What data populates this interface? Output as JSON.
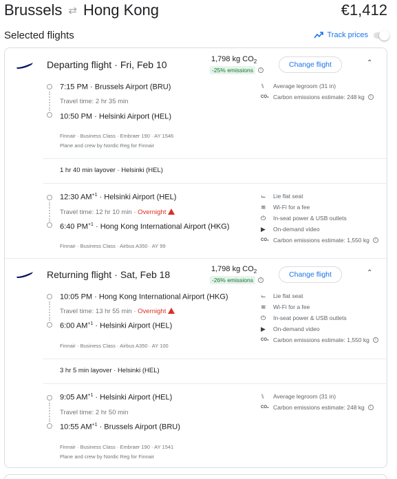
{
  "header": {
    "origin": "Brussels",
    "destination": "Hong Kong",
    "price": "€1,412"
  },
  "selected_title": "Selected flights",
  "track_prices": {
    "label": "Track prices",
    "enabled": false
  },
  "colors": {
    "accent": "#1a73e8",
    "warning": "#d93025",
    "eco_bg": "#e6f4ea",
    "eco_text": "#137333"
  },
  "departing": {
    "title": "Departing flight",
    "date": "Fri, Feb 10",
    "co2": "1,798 kg CO",
    "co2_sub": "2",
    "emissions_badge": "-25% emissions",
    "change_label": "Change flight",
    "segments": [
      {
        "dep_time": "7:15 PM",
        "dep_sup": "",
        "dep_airport": "Brussels Airport (BRU)",
        "travel_time": "Travel time: 2 hr 35 min",
        "overnight": "",
        "arr_time": "10:50 PM",
        "arr_sup": "",
        "arr_airport": "Helsinki Airport (HEL)",
        "details": "Finnair · Business Class · Embraer 190 · AY 1546",
        "operated": "Plane and crew by Nordic Reg for Finnair",
        "amenities": [
          {
            "icon": "legroom-icon",
            "label": "Average legroom (31 in)",
            "info": false
          },
          {
            "icon": "co2-icon",
            "label": "Carbon emissions estimate: 248 kg",
            "info": true
          }
        ]
      },
      {
        "dep_time": "12:30 AM",
        "dep_sup": "+1",
        "dep_airport": "Helsinki Airport (HEL)",
        "travel_time": "Travel time: 12 hr 10 min",
        "overnight": "Overnight",
        "arr_time": "6:40 PM",
        "arr_sup": "+1",
        "arr_airport": "Hong Kong International Airport (HKG)",
        "details": "Finnair · Business Class · Airbus A350 · AY 99",
        "operated": "",
        "amenities": [
          {
            "icon": "lie-flat-seat-icon",
            "label": "Lie flat seat",
            "info": false
          },
          {
            "icon": "wifi-icon",
            "label": "Wi-Fi for a fee",
            "info": false
          },
          {
            "icon": "power-plug-icon",
            "label": "In-seat power & USB outlets",
            "info": false
          },
          {
            "icon": "video-icon",
            "label": "On-demand video",
            "info": false
          },
          {
            "icon": "co2-icon",
            "label": "Carbon emissions estimate: 1,550 kg",
            "info": true
          }
        ]
      }
    ],
    "layover": "1 hr 40 min layover · Helsinki (HEL)"
  },
  "returning": {
    "title": "Returning flight",
    "date": "Sat, Feb 18",
    "co2": "1,798 kg CO",
    "co2_sub": "2",
    "emissions_badge": "-26% emissions",
    "change_label": "Change flight",
    "segments": [
      {
        "dep_time": "10:05 PM",
        "dep_sup": "",
        "dep_airport": "Hong Kong International Airport (HKG)",
        "travel_time": "Travel time: 13 hr 55 min",
        "overnight": "Overnight",
        "arr_time": "6:00 AM",
        "arr_sup": "+1",
        "arr_airport": "Helsinki Airport (HEL)",
        "details": "Finnair · Business Class · Airbus A350 · AY 100",
        "operated": "",
        "amenities": [
          {
            "icon": "lie-flat-seat-icon",
            "label": "Lie flat seat",
            "info": false
          },
          {
            "icon": "wifi-icon",
            "label": "Wi-Fi for a fee",
            "info": false
          },
          {
            "icon": "power-plug-icon",
            "label": "In-seat power & USB outlets",
            "info": false
          },
          {
            "icon": "video-icon",
            "label": "On-demand video",
            "info": false
          },
          {
            "icon": "co2-icon",
            "label": "Carbon emissions estimate: 1,550 kg",
            "info": true
          }
        ]
      },
      {
        "dep_time": "9:05 AM",
        "dep_sup": "+1",
        "dep_airport": "Helsinki Airport (HEL)",
        "travel_time": "Travel time: 2 hr 50 min",
        "overnight": "",
        "arr_time": "10:55 AM",
        "arr_sup": "+1",
        "arr_airport": "Brussels Airport (BRU)",
        "details": "Finnair · Business Class · Embraer 190 · AY 1541",
        "operated": "Plane and crew by Nordic Reg for Finnair",
        "amenities": [
          {
            "icon": "legroom-icon",
            "label": "Average legroom (31 in)",
            "info": false
          },
          {
            "icon": "co2-icon",
            "label": "Carbon emissions estimate: 248 kg",
            "info": true
          }
        ]
      }
    ],
    "layover": "3 hr 5 min layover · Helsinki (HEL)"
  }
}
